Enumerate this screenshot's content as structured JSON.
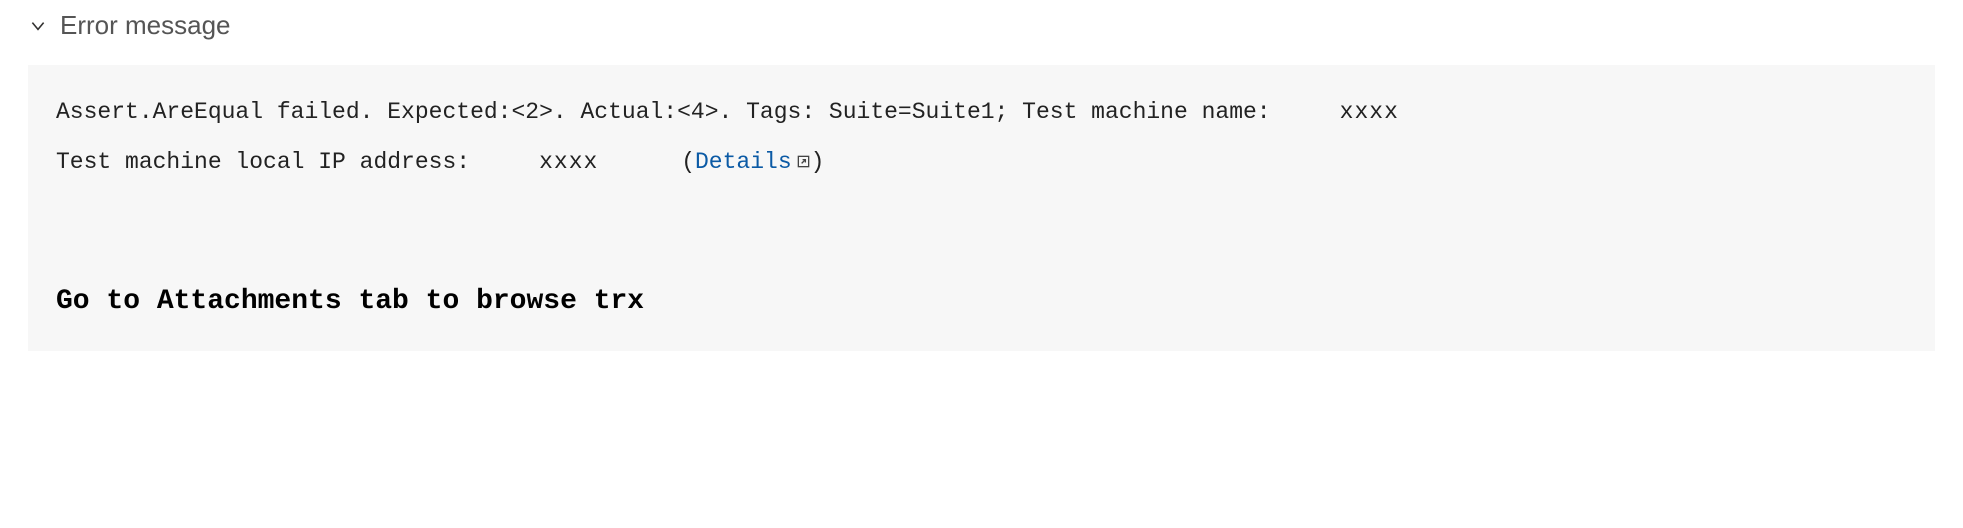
{
  "section": {
    "title": "Error message"
  },
  "error": {
    "line1_pre": "Assert.AreEqual failed. Expected:<2>. Actual:<4>. Tags: Suite=Suite1; Test machine name:",
    "line1_redacted": "xxxx",
    "line2_pre": "Test machine local IP address:",
    "line2_redacted": "xxxx",
    "line2_open_paren": "(",
    "details_label": "Details",
    "line2_close_paren": ")"
  },
  "note": {
    "text": "Go to Attachments tab to browse trx"
  }
}
